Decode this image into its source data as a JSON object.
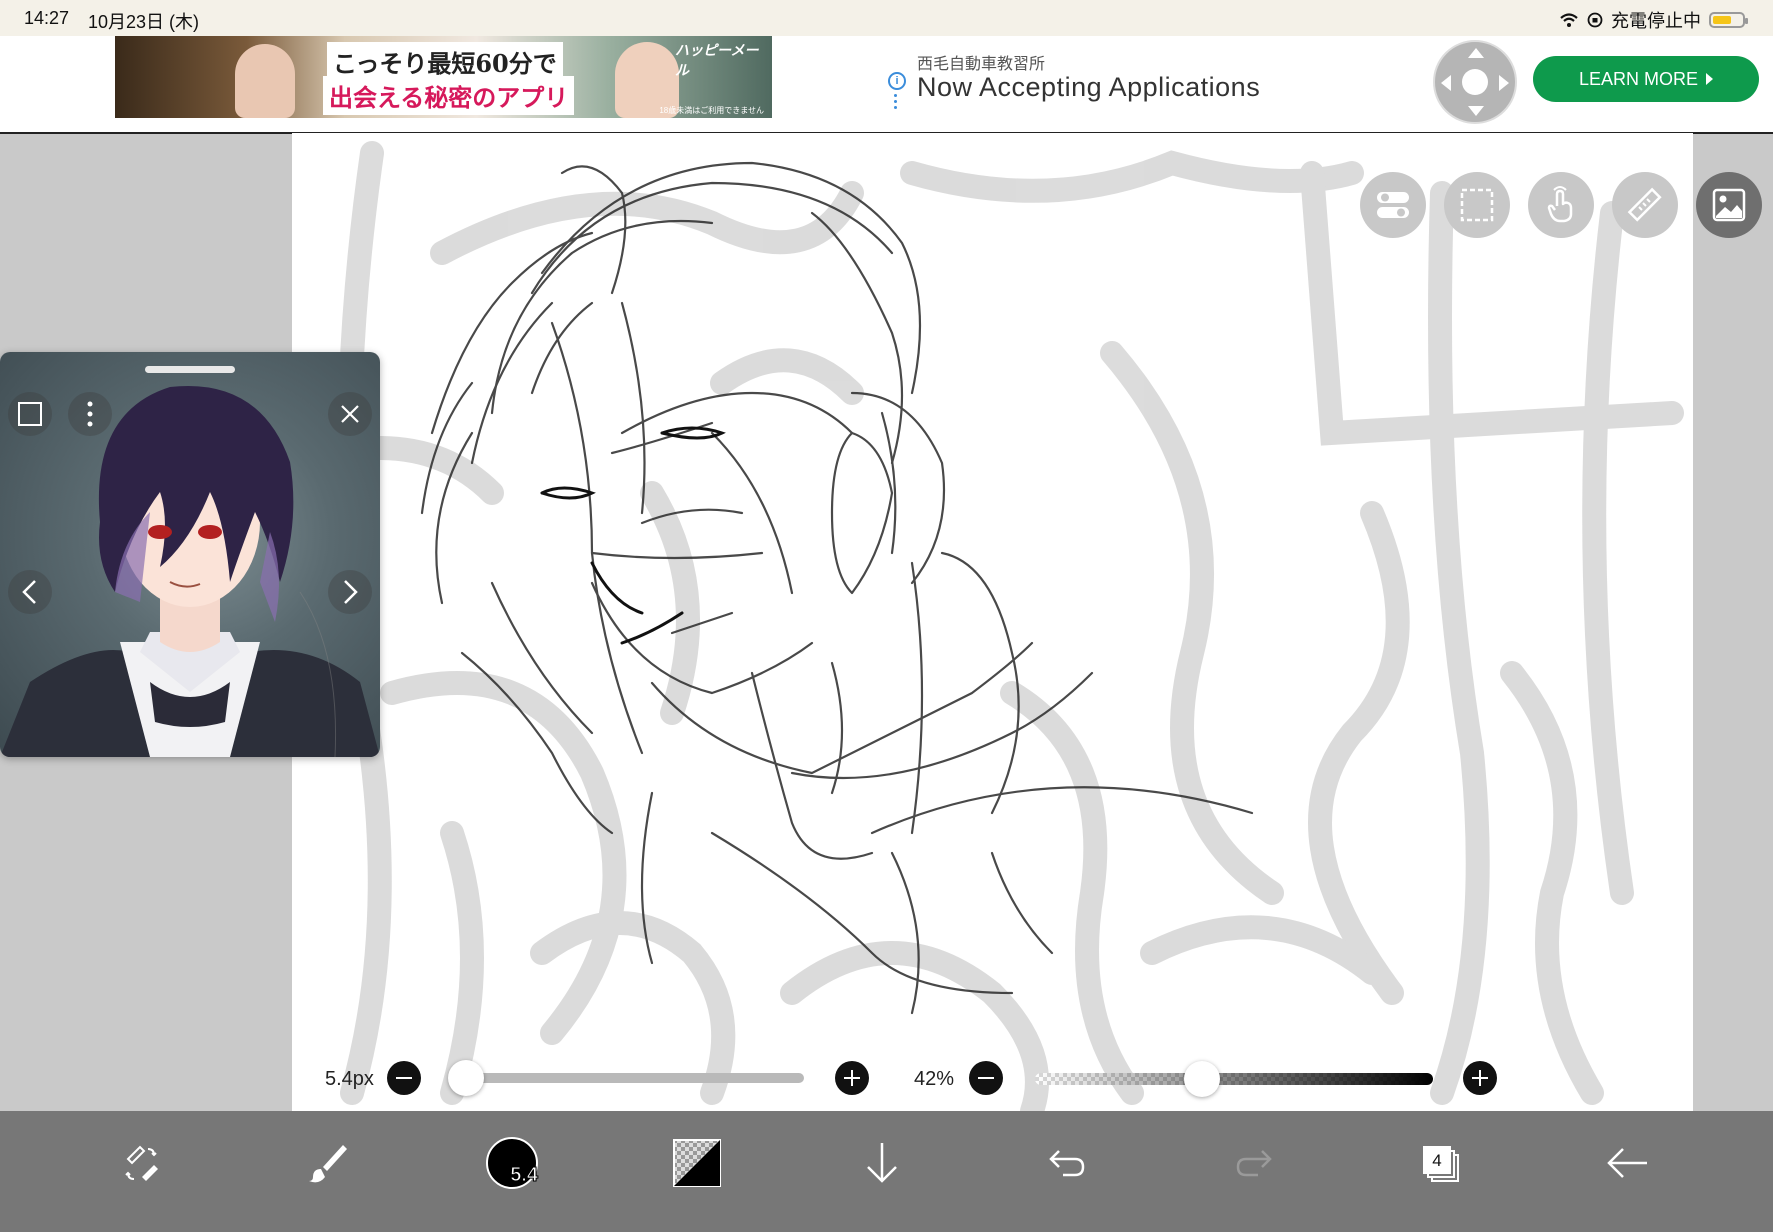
{
  "status_bar": {
    "time": "14:27",
    "date": "10月23日 (木)",
    "charging": "充電停止中"
  },
  "ad": {
    "left_copy1": "こっそり最短60分で",
    "left_copy2": "出会える秘密のアプリ",
    "left_brand": "ハッピーメール",
    "left_note": "18歳未満はご利用できません",
    "sponsor": "西毛自動車教習所",
    "headline": "Now Accepting Applications",
    "cta": "LEARN MORE"
  },
  "sliders": {
    "brush_size_label": "5.4px",
    "opacity_label": "42%",
    "brush_size_fraction": 0.0,
    "opacity_fraction": 0.42
  },
  "toolbar": {
    "brush_size_badge": "5.4",
    "layer_count": "4"
  },
  "colors": {
    "toolbar_bg": "#777777",
    "canvas_bg": "#ffffff",
    "ad_cta": "#0e9a4c",
    "battery": "#f5c518"
  },
  "icons": [
    "wifi-icon",
    "orientation-lock-icon",
    "battery-icon",
    "dpad-icon",
    "toggle-icon",
    "selection-icon",
    "touch-icon",
    "ruler-icon",
    "image-icon",
    "window-icon",
    "more-icon",
    "close-icon",
    "chevron-left-icon",
    "chevron-right-icon",
    "pen-eraser-swap-icon",
    "brush-icon",
    "color-icon",
    "download-icon",
    "undo-icon",
    "redo-icon",
    "layers-icon",
    "back-icon"
  ]
}
